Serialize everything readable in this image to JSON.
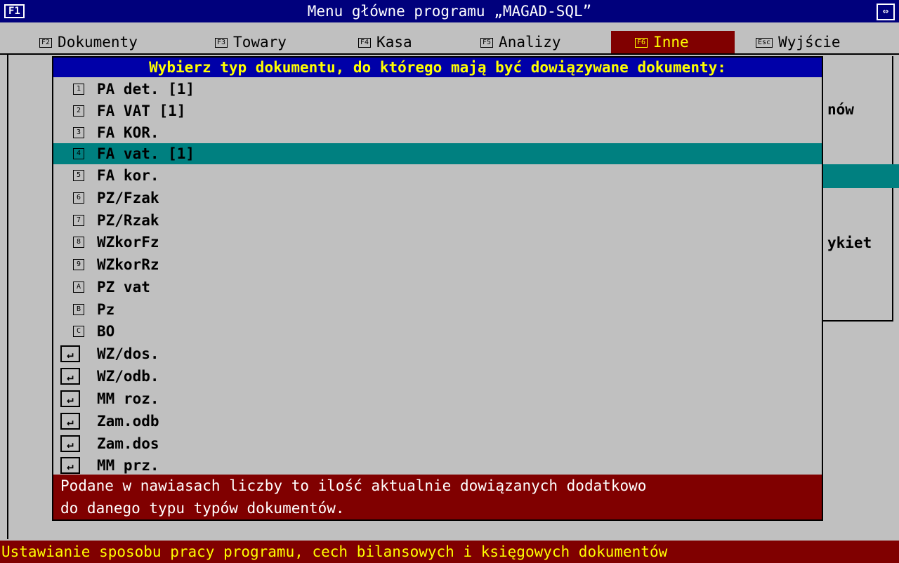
{
  "window": {
    "f1_label": "F1",
    "title": "Menu główne programu „MAGAD-SQL”",
    "resize_icon": "move-resize-icon"
  },
  "menu": [
    {
      "key": "F2",
      "label": "Dokumenty"
    },
    {
      "key": "F3",
      "label": "Towary"
    },
    {
      "key": "F4",
      "label": "Kasa"
    },
    {
      "key": "F5",
      "label": "Analizy"
    },
    {
      "key": "F6",
      "label": "Inne"
    },
    {
      "key": "Esc",
      "label": "Wyjście"
    }
  ],
  "background": {
    "partial_1": "nów",
    "partial_2": "ykiet"
  },
  "dialog": {
    "title": "Wybierz typ dokumentu, do którego mają być dowiązywane dokumenty:",
    "items": [
      {
        "key": "1",
        "label": "PA det. [1]"
      },
      {
        "key": "2",
        "label": "FA VAT [1]"
      },
      {
        "key": "3",
        "label": "FA KOR."
      },
      {
        "key": "4",
        "label": "FA vat. [1]"
      },
      {
        "key": "5",
        "label": "FA kor."
      },
      {
        "key": "6",
        "label": "PZ/Fzak"
      },
      {
        "key": "7",
        "label": "PZ/Rzak"
      },
      {
        "key": "8",
        "label": "WZkorFz"
      },
      {
        "key": "9",
        "label": "WZkorRz"
      },
      {
        "key": "A",
        "label": "PZ vat"
      },
      {
        "key": "B",
        "label": "Pz"
      },
      {
        "key": "C",
        "label": "BO"
      },
      {
        "key": "↵",
        "label": "WZ/dos."
      },
      {
        "key": "↵",
        "label": "WZ/odb."
      },
      {
        "key": "↵",
        "label": "MM roz."
      },
      {
        "key": "↵",
        "label": "Zam.odb"
      },
      {
        "key": "↵",
        "label": "Zam.dos"
      },
      {
        "key": "↵",
        "label": "MM prz."
      }
    ],
    "note_line1": "Podane w nawiasach liczby to ilość aktualnie dowiązanych dodatkowo",
    "note_line2": "do danego typu typów dokumentów."
  },
  "status": "Ustawianie sposobu pracy programu, cech bilansowych i księgowych dokumentów",
  "colors": {
    "title_bg": "#00007c",
    "dialog_title_bg": "#0000a8",
    "highlight": "#008080",
    "active_menu_bg": "#800000",
    "status_bg": "#800000",
    "text_yellow": "#ffff00"
  }
}
